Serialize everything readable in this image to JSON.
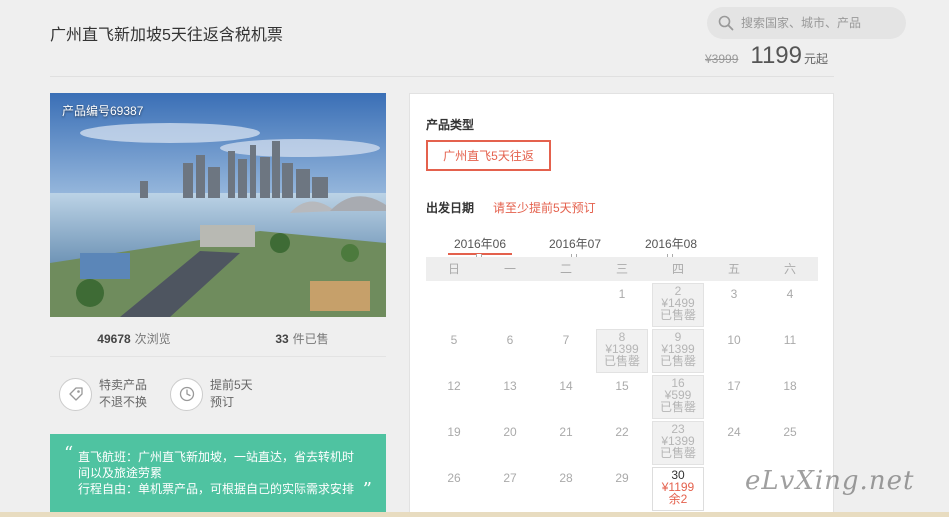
{
  "product": {
    "title": "广州直飞新加坡5天往返含税机票",
    "code_label": "产品编号69387",
    "original_price": "¥3999",
    "price": "1199",
    "price_unit": "元起"
  },
  "search": {
    "placeholder": "搜索国家、城市、产品"
  },
  "stats": {
    "views": "49678",
    "views_label": "次浏览",
    "sold": "33",
    "sold_label": "件已售"
  },
  "features": [
    {
      "line1": "特卖产品",
      "line2": "不退不换",
      "icon": "tag-icon"
    },
    {
      "line1": "提前5天",
      "line2": "预订",
      "icon": "clock-icon"
    }
  ],
  "description": {
    "open_quote": "“",
    "close_quote": "”",
    "line1": "直飞航班：广州直飞新加坡，一站直达，省去转机时",
    "line2": "间以及旅途劳累",
    "line3": "行程自由：单机票产品，可根据自己的实际需求安排"
  },
  "booking": {
    "type_label": "产品类型",
    "type_option": "广州直飞5天往返",
    "depart_label": "出发日期",
    "depart_note": "请至少提前5天预订",
    "months": [
      "2016年06",
      "2016年07",
      "2016年08"
    ],
    "active_month": "2016年06",
    "weekdays": [
      "日",
      "一",
      "二",
      "三",
      "四",
      "五",
      "六"
    ]
  },
  "calendar": {
    "rows": [
      [
        {
          "d": ""
        },
        {
          "d": ""
        },
        {
          "d": ""
        },
        {
          "d": "1"
        },
        {
          "d": "2",
          "p": "¥1499",
          "s": "已售罄",
          "st": "sold"
        },
        {
          "d": "3"
        },
        {
          "d": "4"
        }
      ],
      [
        {
          "d": "5"
        },
        {
          "d": "6"
        },
        {
          "d": "7"
        },
        {
          "d": "8",
          "p": "¥1399",
          "s": "已售罄",
          "st": "sold"
        },
        {
          "d": "9",
          "p": "¥1399",
          "s": "已售罄",
          "st": "sold"
        },
        {
          "d": "10"
        },
        {
          "d": "11"
        }
      ],
      [
        {
          "d": "12"
        },
        {
          "d": "13"
        },
        {
          "d": "14"
        },
        {
          "d": "15"
        },
        {
          "d": "16",
          "p": "¥599",
          "s": "已售罄",
          "st": "sold"
        },
        {
          "d": "17"
        },
        {
          "d": "18"
        }
      ],
      [
        {
          "d": "19"
        },
        {
          "d": "20"
        },
        {
          "d": "21"
        },
        {
          "d": "22"
        },
        {
          "d": "23",
          "p": "¥1399",
          "s": "已售罄",
          "st": "sold"
        },
        {
          "d": "24"
        },
        {
          "d": "25"
        }
      ],
      [
        {
          "d": "26"
        },
        {
          "d": "27"
        },
        {
          "d": "28"
        },
        {
          "d": "29"
        },
        {
          "d": "30",
          "p": "¥1199",
          "s": "余2",
          "st": "avail"
        },
        {
          "d": ""
        },
        {
          "d": ""
        }
      ]
    ]
  },
  "watermark": "eLvXing.net",
  "colors": {
    "accent": "#e4614d",
    "teal": "#4fc3a1"
  }
}
